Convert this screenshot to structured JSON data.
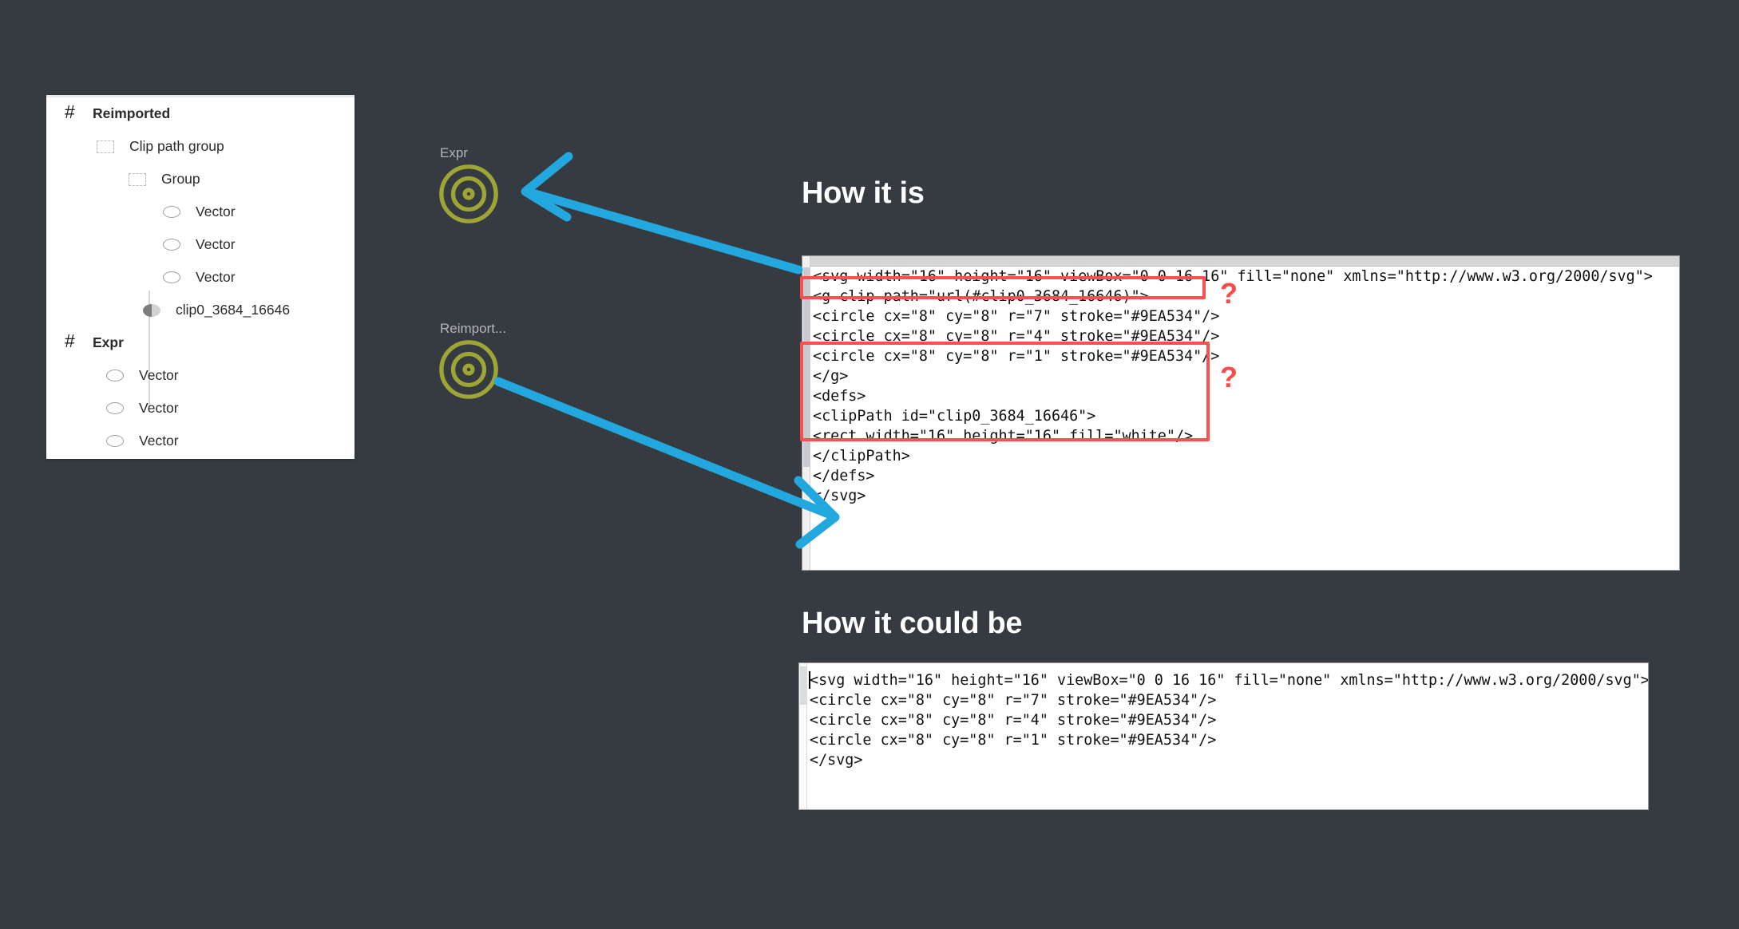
{
  "theme": {
    "background": "#353b40",
    "panel_bg": "#ffffff",
    "heading_color": "#ffffff",
    "arrow_color": "#22a7de",
    "highlight_color": "#fa5050",
    "target_stroke": "#9EA534",
    "code_text_color": "#111111"
  },
  "layers_panel": {
    "items": [
      {
        "label": "Reimported",
        "icon": "frame-icon",
        "depth": 0,
        "bold": true
      },
      {
        "label": "Clip path group",
        "icon": "group-icon",
        "depth": 1,
        "bold": false
      },
      {
        "label": "Group",
        "icon": "group-icon",
        "depth": 2,
        "bold": false
      },
      {
        "label": "Vector",
        "icon": "ellipse-icon",
        "depth": 3,
        "bold": false
      },
      {
        "label": "Vector",
        "icon": "ellipse-icon",
        "depth": 3,
        "bold": false
      },
      {
        "label": "Vector",
        "icon": "ellipse-icon",
        "depth": 3,
        "bold": false
      },
      {
        "label": "clip0_3684_16646",
        "icon": "mask-icon",
        "depth": 2,
        "bold": false
      },
      {
        "label": "Expr",
        "icon": "frame-icon",
        "depth": 0,
        "bold": true
      },
      {
        "label": "Vector",
        "icon": "ellipse-icon",
        "depth": 1,
        "bold": false
      },
      {
        "label": "Vector",
        "icon": "ellipse-icon",
        "depth": 1,
        "bold": false
      },
      {
        "label": "Vector",
        "icon": "ellipse-icon",
        "depth": 1,
        "bold": false
      }
    ]
  },
  "canvas": {
    "objects": [
      {
        "label": "Expr",
        "icon": "target-icon"
      },
      {
        "label": "Reimport...",
        "icon": "target-icon"
      }
    ]
  },
  "sections": {
    "how_it_is": {
      "heading": "How it is",
      "code": "<svg width=\"16\" height=\"16\" viewBox=\"0 0 16 16\" fill=\"none\" xmlns=\"http://www.w3.org/2000/svg\">\n<g clip-path=\"url(#clip0_3684_16646)\">\n<circle cx=\"8\" cy=\"8\" r=\"7\" stroke=\"#9EA534\"/>\n<circle cx=\"8\" cy=\"8\" r=\"4\" stroke=\"#9EA534\"/>\n<circle cx=\"8\" cy=\"8\" r=\"1\" stroke=\"#9EA534\"/>\n</g>\n<defs>\n<clipPath id=\"clip0_3684_16646\">\n<rect width=\"16\" height=\"16\" fill=\"white\"/>\n</clipPath>\n</defs>\n</svg>",
      "annotations": [
        {
          "marker": "?",
          "target": "g-clip-path-line"
        },
        {
          "marker": "?",
          "target": "defs-clippath-block"
        }
      ]
    },
    "how_it_could_be": {
      "heading": "How it could be",
      "code": "<svg width=\"16\" height=\"16\" viewBox=\"0 0 16 16\" fill=\"none\" xmlns=\"http://www.w3.org/2000/svg\">\n<circle cx=\"8\" cy=\"8\" r=\"7\" stroke=\"#9EA534\"/>\n<circle cx=\"8\" cy=\"8\" r=\"4\" stroke=\"#9EA534\"/>\n<circle cx=\"8\" cy=\"8\" r=\"1\" stroke=\"#9EA534\"/>\n</svg>"
    }
  }
}
